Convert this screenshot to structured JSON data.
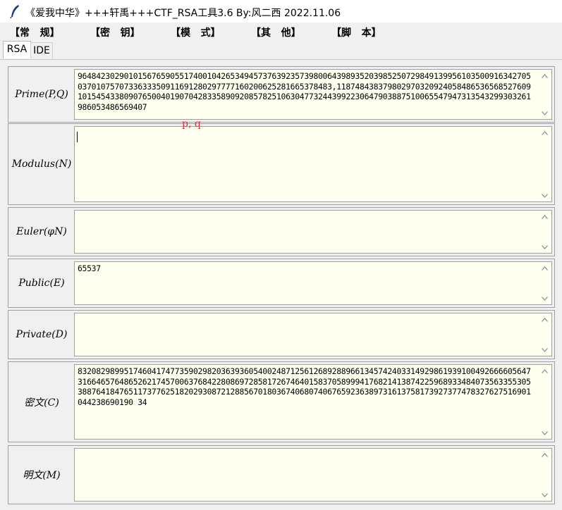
{
  "window": {
    "title": "《爱我中华》+++轩禹+++CTF_RSA工具3.6   By:风二西 2022.11.06"
  },
  "menu": [
    "【常   规】",
    "【密   钥】",
    "【模   式】",
    "【其   他】",
    "【脚   本】"
  ],
  "tabs": [
    "RSA",
    "IDE"
  ],
  "active_tab": "RSA",
  "fields": {
    "prime": {
      "label": "Prime(P,Q)",
      "value": "964842302901015676590551740010426534945737639235739800643989352039852507298491399561035009163427050370107570733633350911691280297777160200625281665378483,11874843837980297032092405848653656852760910154543380907650040190704283358909208578251063047732443992230647903887510065547947313543299303261986053486569407"
    },
    "modulus": {
      "label": "Modulus(N)",
      "value": ""
    },
    "hint": "p, q",
    "euler": {
      "label": "Euler(φN)",
      "value": ""
    },
    "public": {
      "label": "Public(E)",
      "value": "65537"
    },
    "private": {
      "label": "Private(D)",
      "value": ""
    },
    "cipher": {
      "label": "密文(C)",
      "value": "832082989951746041747735902982036393605400248712561268928896613457424033149298619391004926666056473166465764865262174570063768422808697285817267464015837058999417682141387422596893348407356335530538876418476511737762518202930872128856701803674068074067659236389731613758173927377478327627516901044238690190 34"
    },
    "plain": {
      "label": "明文(M)",
      "value": ""
    }
  },
  "icons": {
    "window": "feather-pen-icon",
    "scroll_up": "chevron-up-icon",
    "scroll_down": "chevron-down-icon"
  }
}
